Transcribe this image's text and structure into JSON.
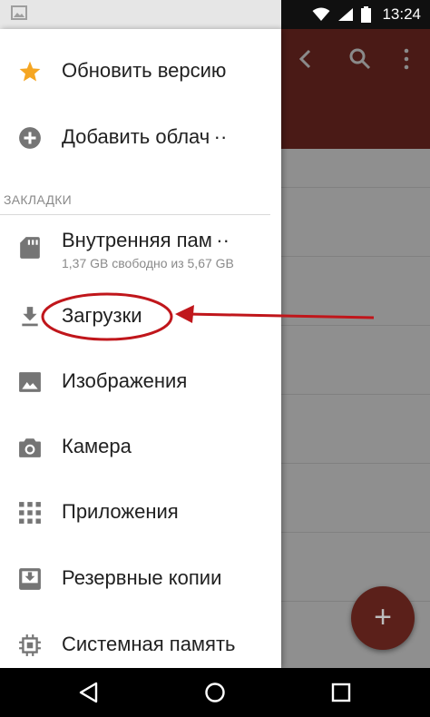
{
  "status_bar": {
    "time": "13:24",
    "icons": [
      "image-notification-icon",
      "wifi-icon",
      "signal-icon",
      "battery-icon"
    ]
  },
  "drawer": {
    "top_items": [
      {
        "label": "Обновить версию",
        "icon": "star-icon"
      },
      {
        "label": "Добавить облач ··",
        "icon": "add-circle-icon"
      }
    ],
    "section_header": "ЗАКЛАДКИ",
    "bookmarks": [
      {
        "label": "Внутренняя пам ··",
        "sub": "1,37 GB свободно из 5,67 GB",
        "icon": "sd-card-icon"
      },
      {
        "label": "Загрузки",
        "icon": "download-icon"
      },
      {
        "label": "Изображения",
        "icon": "image-icon"
      },
      {
        "label": "Камера",
        "icon": "camera-icon"
      },
      {
        "label": "Приложения",
        "icon": "apps-grid-icon"
      },
      {
        "label": "Резервные копии",
        "icon": "backup-icon"
      },
      {
        "label": "Системная память",
        "icon": "chip-icon"
      }
    ]
  },
  "app_bar": {
    "icons": [
      "back-icon",
      "search-icon",
      "more-vert-icon"
    ]
  },
  "fab": {
    "label": "+"
  },
  "colors": {
    "toolbar_dimmed": "#4a1a16",
    "accent_star": "#f5a623",
    "annotation_red": "#c0161b"
  }
}
